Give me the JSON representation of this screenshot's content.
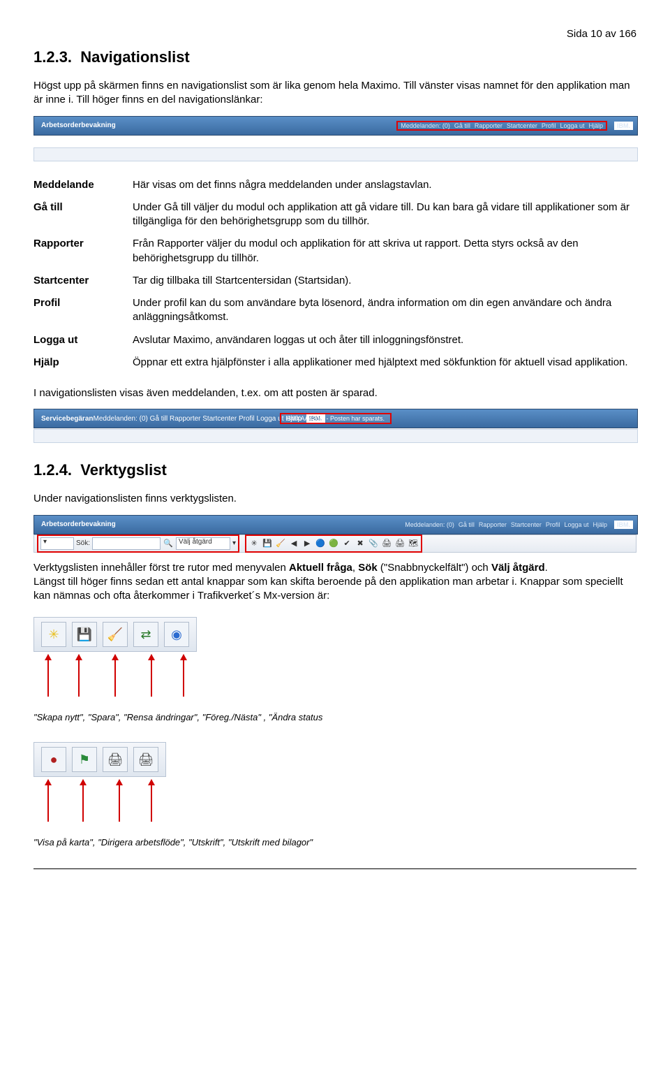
{
  "page_number": "Sida 10 av 166",
  "section1": {
    "number": "1.2.3.",
    "title": "Navigationslist",
    "intro": "Högst upp på skärmen finns en navigationslist som är lika genom hela Maximo. Till vänster visas namnet för den applikation man är inne i. Till höger finns en del navigationslänkar:"
  },
  "navbar": {
    "app_title": "Arbetsorderbevakning",
    "links": [
      "Meddelanden: (0)",
      "Gå till",
      "Rapporter",
      "Startcenter",
      "Profil",
      "Logga ut",
      "Hjälp"
    ],
    "logo": "IBM."
  },
  "definitions": [
    {
      "term": "Meddelande",
      "desc": "Här visas om det finns några meddelanden under anslagstavlan."
    },
    {
      "term": "Gå till",
      "desc": "Under Gå till väljer du modul och applikation att gå vidare till. Du kan bara gå vidare till applikationer som är tillgängliga för den behörighetsgrupp som du tillhör."
    },
    {
      "term": "Rapporter",
      "desc": "Från Rapporter väljer du modul och applikation för att skriva ut rapport. Detta styrs också av den behörighetsgrupp du tillhör."
    },
    {
      "term": "Startcenter",
      "desc": "Tar dig tillbaka till Startcentersidan (Startsidan)."
    },
    {
      "term": "Profil",
      "desc": "Under profil kan du som användare byta lösenord, ändra information om din egen användare och ändra anläggningsåtkomst."
    },
    {
      "term": "Logga ut",
      "desc": "Avslutar Maximo, användaren loggas ut och åter till inloggningsfönstret."
    },
    {
      "term": "Hjälp",
      "desc": "Öppnar ett extra hjälpfönster i alla applikationer med hjälptext med sökfunktion för aktuell visad applikation."
    }
  ],
  "after_table": "I navigationslisten visas även meddelanden, t.ex. om att posten är sparad.",
  "msgbar": {
    "app_title": "Servicebegäran",
    "message": "BMXAA4205I - Posten har sparats."
  },
  "section2": {
    "number": "1.2.4.",
    "title": "Verktygslist",
    "intro": "Under navigationslisten finns verktygslisten."
  },
  "toolbar_labels": {
    "sok": "Sök:",
    "valj": "Välj åtgärd"
  },
  "toolbar_desc": {
    "line1a": "Verktygslisten innehåller först tre rutor med menyvalen ",
    "bold1": "Aktuell fråga",
    "sep1": ", ",
    "bold2": "Sök",
    "paren": " (\"Snabbnyckelfält\") och ",
    "bold3": "Välj åtgärd",
    "period": ".",
    "line2": "Längst till höger finns sedan ett antal knappar som kan skifta beroende på den applikation man arbetar i. Knappar som speciellt kan nämnas och ofta återkommer i Trafikverket´s Mx-version är:"
  },
  "caption1": "\"Skapa nytt\", \"Spara\", \"Rensa ändringar\", \"Föreg./Nästa\" , \"Ändra status",
  "caption2": "\"Visa på karta\", \"Dirigera arbetsflöde\", \"Utskrift\", \"Utskrift med bilagor\""
}
